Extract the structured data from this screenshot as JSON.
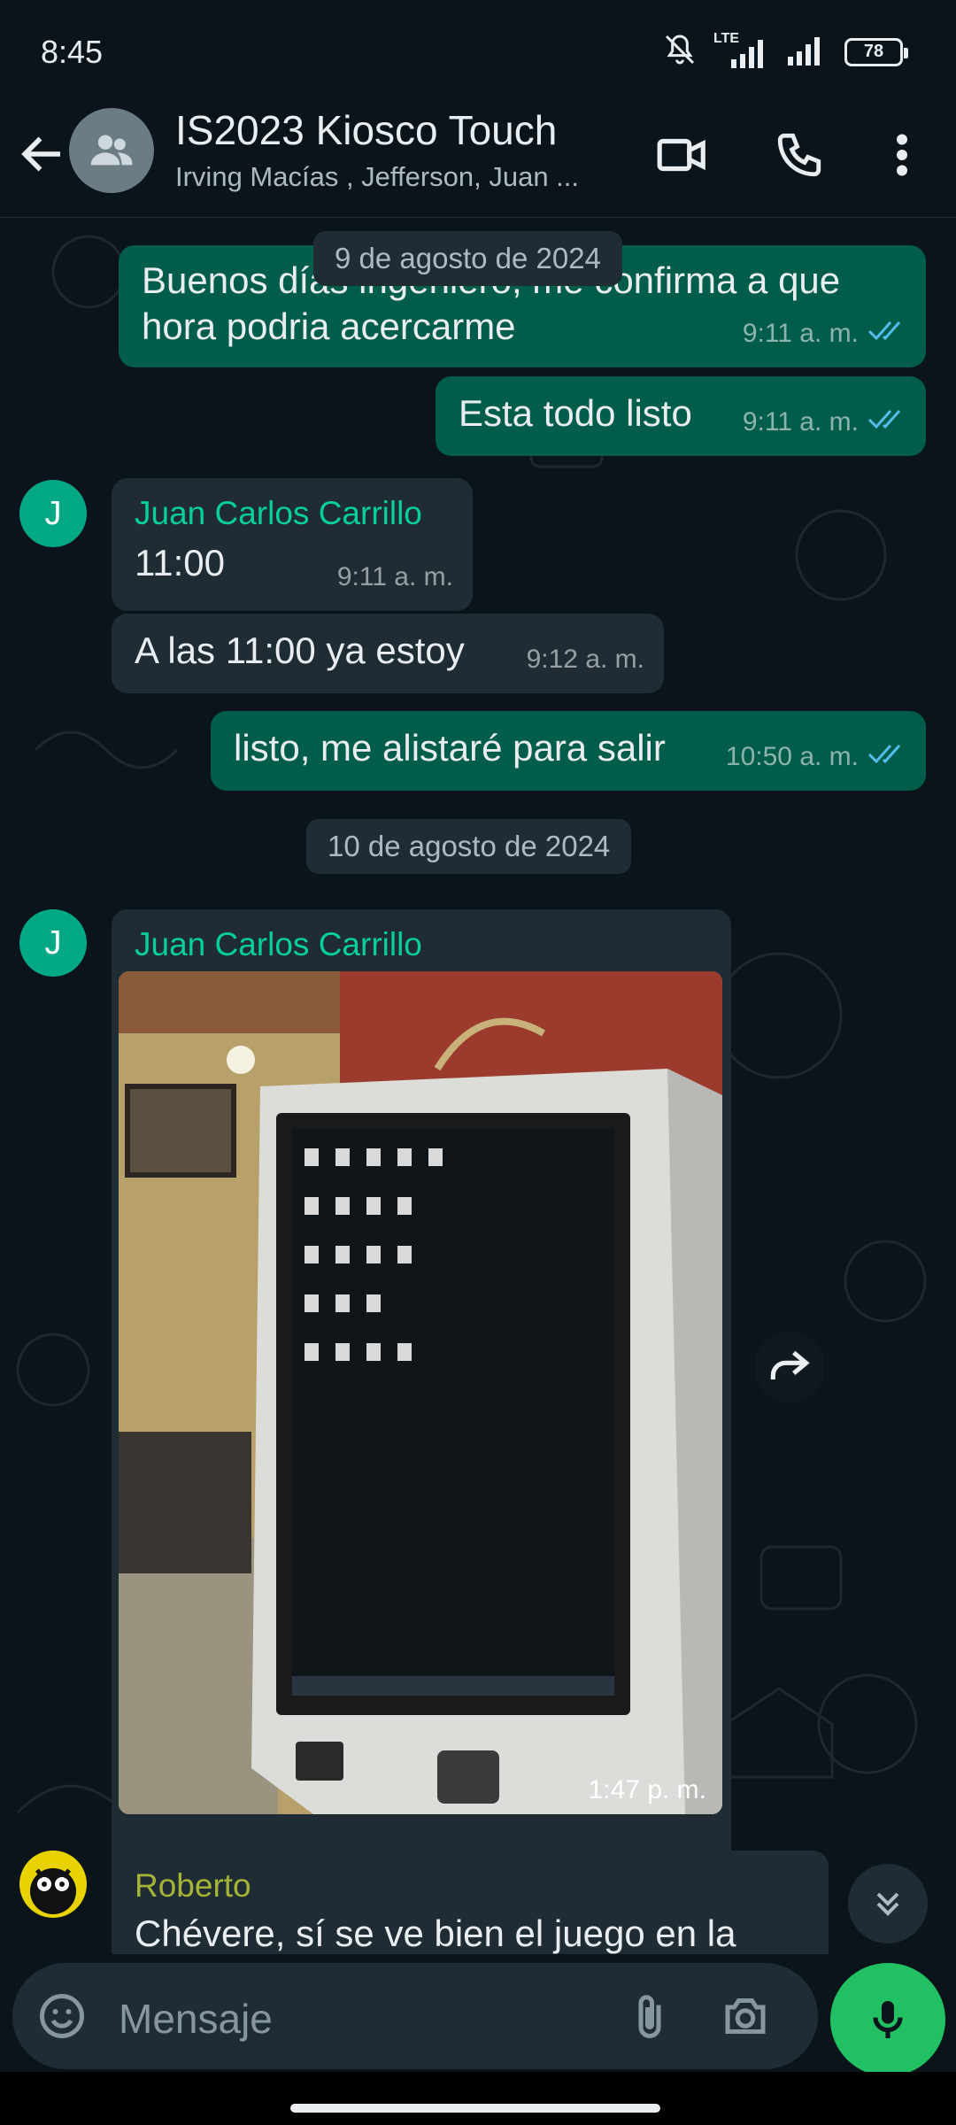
{
  "status_bar": {
    "time": "8:45",
    "network": "LTE",
    "battery": "78"
  },
  "header": {
    "title": "IS2023 Kiosco Touch",
    "subtitle": "Irving Macías , Jefferson, Juan ...",
    "icons": [
      "back-arrow-icon",
      "group-avatar-icon",
      "video-call-icon",
      "voice-call-icon",
      "more-options-icon"
    ]
  },
  "messages": {
    "date1": "9 de agosto de 2024",
    "m1": {
      "text": "Buenos días ingeniero, me confirma a que hora podria acercarme",
      "line1": "Buenos días ingeniero, me confirma a que",
      "line2": "hora podria acercarme",
      "time": "9:11 a. m."
    },
    "m2": {
      "text": "Esta todo listo",
      "time": "9:11 a. m."
    },
    "m3": {
      "sender": "Juan Carlos Carrillo",
      "initial": "J",
      "text": "11:00",
      "time": "9:11 a. m."
    },
    "m4": {
      "text": "A las 11:00 ya estoy",
      "time": "9:12 a. m."
    },
    "m5": {
      "text": "listo, me alistaré para salir",
      "time": "10:50 a. m."
    },
    "date2": "10 de agosto de 2024",
    "m6": {
      "sender": "Juan Carlos Carrillo",
      "initial": "J",
      "time": "1:47 p. m."
    },
    "m7": {
      "sender": "Roberto",
      "text": "Chévere, sí se ve bien el juego en la"
    }
  },
  "input": {
    "placeholder": "Mensaje"
  },
  "colors": {
    "accent": "#00a884",
    "outgoing": "#005c4b",
    "incoming": "#1f2c33",
    "read_ticks": "#53bdeb",
    "mic": "#21c063"
  }
}
